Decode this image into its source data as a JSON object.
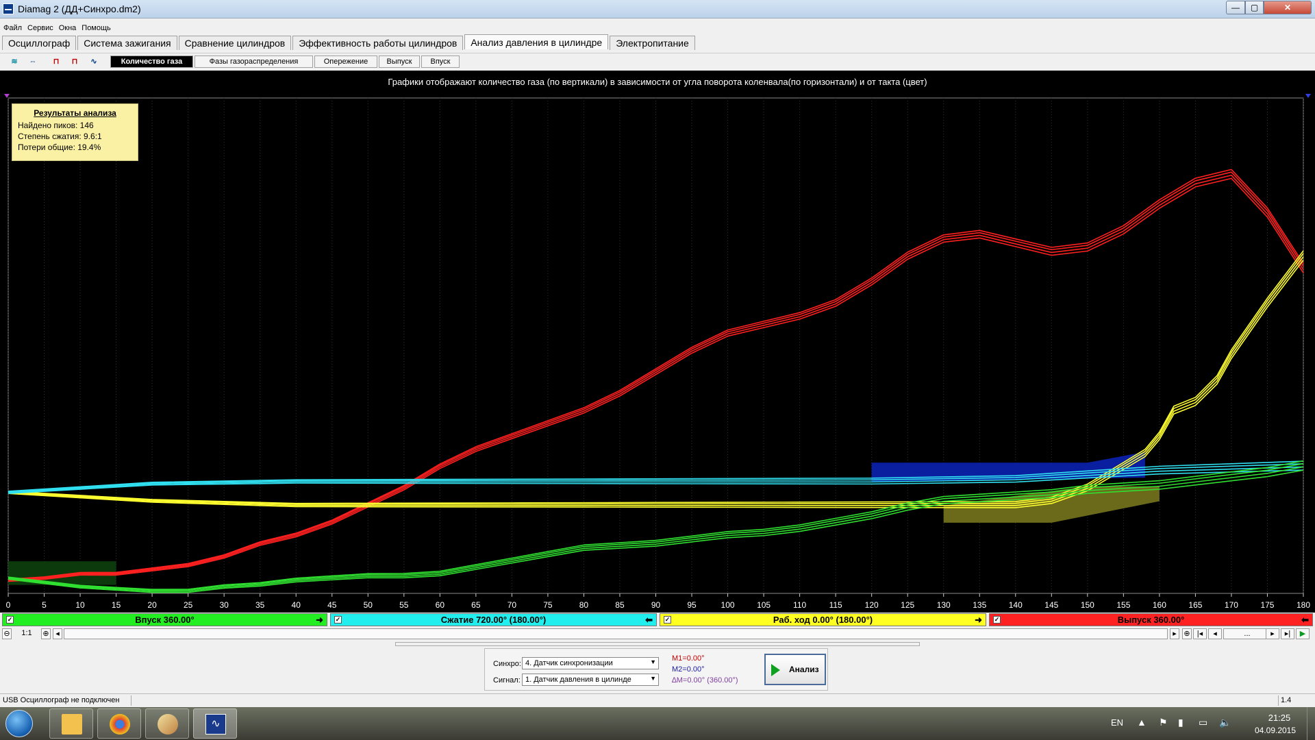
{
  "window": {
    "title": "Diamag 2 (ДД+Синхро.dm2)",
    "minimize": "—",
    "maximize": "▢",
    "close": "✕"
  },
  "menu": [
    "Файл",
    "Сервис",
    "Окна",
    "Помощь"
  ],
  "main_tabs": [
    "Осциллограф",
    "Система зажигания",
    "Сравнение цилиндров",
    "Эффективность работы цилиндров",
    "Анализ давления в цилиндре",
    "Электропитание"
  ],
  "main_tab_active": 4,
  "sub_tabs": [
    "Количество газа",
    "Фазы газораспределения",
    "Опережение",
    "Выпуск",
    "Впуск"
  ],
  "sub_tab_active": 0,
  "toolbar_icons": [
    "zoom-fit-icon",
    "zoom-range-icon",
    "cursor-markers-icon",
    "auto-markers-icon",
    "envelope-icon"
  ],
  "chart_caption": "Графики отображают количество газа (по вертикали) в зависимости от угла поворота коленвала(по горизонтали) и от такта (цвет)",
  "results": {
    "title": "Результаты анализа",
    "peaks": "Найдено пиков: 146",
    "compression": "Степень сжатия: 9.6:1",
    "losses": "Потери общие: 19.4%"
  },
  "chart_data": {
    "type": "line",
    "xlabel": "",
    "ylabel": "",
    "xlim": [
      0,
      180
    ],
    "ylim": [
      0,
      1
    ],
    "x_ticks": [
      0,
      5,
      10,
      15,
      20,
      25,
      30,
      35,
      40,
      45,
      50,
      55,
      60,
      65,
      70,
      75,
      80,
      85,
      90,
      95,
      100,
      105,
      110,
      115,
      120,
      125,
      130,
      135,
      140,
      145,
      150,
      155,
      160,
      165,
      170,
      175,
      180
    ],
    "y_scale_note": "no y tick labels shown; values normalized 0–1",
    "series": [
      {
        "color": "#ff2020",
        "x": [
          0,
          5,
          10,
          15,
          20,
          25,
          30,
          35,
          40,
          45,
          50,
          55,
          60,
          65,
          70,
          75,
          80,
          85,
          90,
          95,
          100,
          105,
          110,
          115,
          120,
          125,
          130,
          135,
          140,
          145,
          150,
          155,
          160,
          165,
          170,
          175,
          180
        ],
        "y": [
          0.025,
          0.03,
          0.04,
          0.04,
          0.05,
          0.06,
          0.08,
          0.11,
          0.13,
          0.16,
          0.2,
          0.24,
          0.29,
          0.33,
          0.36,
          0.39,
          0.42,
          0.46,
          0.51,
          0.56,
          0.6,
          0.62,
          0.64,
          0.67,
          0.72,
          0.78,
          0.82,
          0.83,
          0.81,
          0.79,
          0.8,
          0.84,
          0.9,
          0.95,
          0.97,
          0.88,
          0.75
        ]
      },
      {
        "color": "#ffff30",
        "x": [
          0,
          10,
          20,
          30,
          40,
          50,
          60,
          70,
          80,
          90,
          100,
          110,
          120,
          130,
          140,
          145,
          150,
          155,
          158,
          160,
          162,
          165,
          168,
          170,
          175,
          180
        ],
        "y": [
          0.23,
          0.22,
          0.21,
          0.205,
          0.2,
          0.2,
          0.2,
          0.2,
          0.2,
          0.2,
          0.2,
          0.2,
          0.2,
          0.2,
          0.2,
          0.21,
          0.24,
          0.29,
          0.32,
          0.36,
          0.42,
          0.44,
          0.49,
          0.55,
          0.67,
          0.78
        ]
      },
      {
        "color": "#30e0f0",
        "x": [
          0,
          20,
          40,
          60,
          80,
          100,
          120,
          140,
          150,
          160,
          170,
          180
        ],
        "y": [
          0.23,
          0.25,
          0.255,
          0.255,
          0.255,
          0.255,
          0.255,
          0.26,
          0.27,
          0.28,
          0.285,
          0.29
        ]
      },
      {
        "color": "#30e030",
        "x": [
          0,
          5,
          10,
          15,
          20,
          25,
          30,
          35,
          40,
          45,
          50,
          55,
          60,
          65,
          70,
          75,
          80,
          85,
          90,
          95,
          100,
          105,
          110,
          115,
          120,
          125,
          130,
          135,
          140,
          145,
          150,
          155,
          160,
          165,
          170,
          175,
          180
        ],
        "y": [
          0.03,
          0.02,
          0.01,
          0.005,
          0.0,
          0.0,
          0.01,
          0.015,
          0.025,
          0.03,
          0.035,
          0.035,
          0.04,
          0.055,
          0.07,
          0.085,
          0.1,
          0.105,
          0.11,
          0.12,
          0.13,
          0.135,
          0.145,
          0.16,
          0.175,
          0.195,
          0.21,
          0.215,
          0.22,
          0.225,
          0.235,
          0.24,
          0.245,
          0.255,
          0.265,
          0.275,
          0.29
        ]
      }
    ],
    "phases": [
      {
        "label": "Впуск 360.00°",
        "color": "#22ee22"
      },
      {
        "label": "Сжатие 720.00° (180.00°)",
        "color": "#22eeee"
      },
      {
        "label": "Раб. ход 0.00° (180.00°)",
        "color": "#ffff22"
      },
      {
        "label": "Выпуск 360.00°",
        "color": "#ff2222"
      }
    ]
  },
  "zoom": {
    "minus": "⊖",
    "ratio": "1:1",
    "plus": "⊕",
    "left": "◂"
  },
  "nav": {
    "first": "|◂",
    "prev": "◂",
    "dots": "...",
    "next": "▸",
    "last": "▸|",
    "play": "▶"
  },
  "panel": {
    "sync_label": "Синхро:",
    "sync_value": "4.  Датчик синхронизации",
    "signal_label": "Сигнал:",
    "signal_value": "1.  Датчик давления в цилинде",
    "m1": "M1=0.00°",
    "m2": "M2=0.00°",
    "dm": "∆M=0.00° (360.00°)",
    "analyze": "Анализ",
    "colors": {
      "m1": "#c00000",
      "m2": "#1a1aa0",
      "dm": "#8040a0"
    }
  },
  "status": {
    "text": "USB Осциллограф не подключен",
    "right": "1.4"
  },
  "taskbar": {
    "lang": "EN",
    "time": "21:25",
    "date": "04.09.2015"
  }
}
